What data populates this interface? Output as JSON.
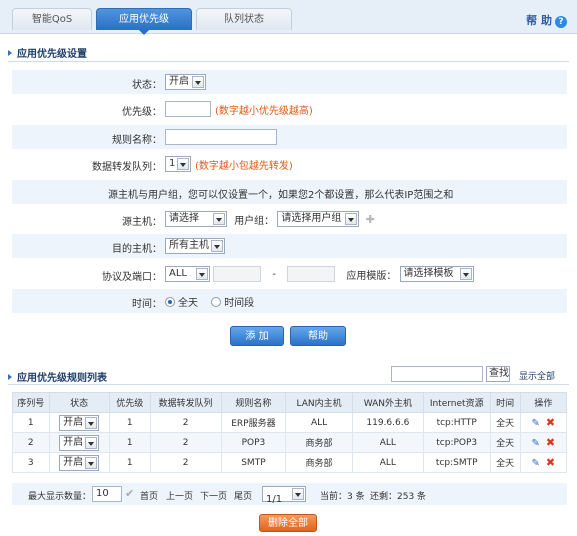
{
  "tabs": [
    {
      "label": "智能QoS"
    },
    {
      "label": "应用优先级"
    },
    {
      "label": "队列状态"
    }
  ],
  "help": {
    "label": "帮 助"
  },
  "settings": {
    "title": "应用优先级设置",
    "status": {
      "label": "状态：",
      "value": "开启"
    },
    "priority": {
      "label": "优先级：",
      "hint": "(数字越小优先级越高)"
    },
    "rule_name": {
      "label": "规则名称："
    },
    "queue": {
      "label": "数据转发队列：",
      "value": "1",
      "hint": "(数字越小包越先转发)"
    },
    "note": "源主机与用户组，您可以仅设置一个，如果您2个都设置，那么代表IP范围之和",
    "source_host": {
      "label": "源主机：",
      "value": "请选择"
    },
    "user_group": {
      "label": "用户组：",
      "value": "请选择用户组"
    },
    "dest_host": {
      "label": "目的主机：",
      "value": "所有主机"
    },
    "protocol": {
      "label": "协议及端口：",
      "value": "ALL",
      "dash": "-"
    },
    "app_template": {
      "label": "应用模版：",
      "value": "请选择模板"
    },
    "time": {
      "label": "时间：",
      "opt_all": "全天",
      "opt_period": "时间段"
    },
    "add_button": "添 加",
    "help_button": "帮助"
  },
  "list": {
    "title": "应用优先级规则列表",
    "search_button": "查找",
    "show_all": "显示全部",
    "columns": [
      "序列号",
      "状态",
      "优先级",
      "数据转发队列",
      "规则名称",
      "LAN内主机",
      "WAN外主机",
      "Internet资源",
      "时间",
      "操作"
    ],
    "rows": [
      {
        "seq": "1",
        "status": "开启",
        "priority": "1",
        "queue": "2",
        "name": "ERP服务器",
        "lan": "ALL",
        "wan": "119.6.6.6",
        "inet": "tcp:HTTP",
        "time": "全天"
      },
      {
        "seq": "2",
        "status": "开启",
        "priority": "1",
        "queue": "2",
        "name": "POP3",
        "lan": "商务部",
        "wan": "ALL",
        "inet": "tcp:POP3",
        "time": "全天"
      },
      {
        "seq": "3",
        "status": "开启",
        "priority": "1",
        "queue": "2",
        "name": "SMTP",
        "lan": "商务部",
        "wan": "ALL",
        "inet": "tcp:SMTP",
        "time": "全天"
      }
    ],
    "pager": {
      "max_label": "最大显示数量：",
      "max_value": "10",
      "first": "首页",
      "prev": "上一页",
      "next": "下一页",
      "last": "尾页",
      "page": "1/1",
      "current": "当前：3 条",
      "total": "还剩：253 条"
    },
    "delete_all": "删除全部"
  },
  "colors": {
    "accent": "#2b6fc4",
    "hint": "#e05a14",
    "danger": "#e2621d"
  }
}
